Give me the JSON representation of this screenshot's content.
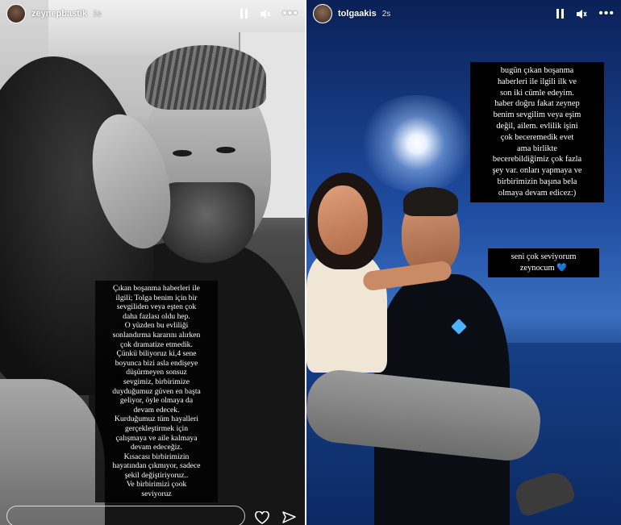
{
  "left_story": {
    "username": "zeynepbastik",
    "time": "1s",
    "caption_lines": [
      "Çıkan boşanma haberleri ile",
      "ilgili; Tolga benim için bir",
      "sevgiliden veya eşten çok",
      "daha fazlası oldu hep.",
      "O yüzden bu evliliği",
      "sonlandırma kararını alırken",
      "çok dramatize etmedik.",
      "Çünkü biliyoruz ki,4 sene",
      "boyunca bizi asla endişeye",
      "düşürmeyen sonsuz",
      "sevgimiz, birbirimize",
      "duyduğumuz güven en başta",
      "geliyor, öyle olmaya da",
      "devam edecek.",
      "Kurduğumuz tüm hayalleri",
      "gerçekleştirmek için",
      "çalışmaya ve aile kalmaya",
      "devam edeceğiz.",
      "Kısacası birbirimizin",
      "hayatından çıkmıyor, sadece",
      "şekil değiştiriyoruz..",
      "Ve birbirimizi çook",
      "seviyoruz"
    ],
    "icons": {
      "pause": "pause-icon",
      "mute": "mute-icon",
      "more": "more-icon",
      "like": "heart-icon",
      "share": "send-icon"
    }
  },
  "right_story": {
    "username": "tolgaakis",
    "time": "2s",
    "caption_lines": [
      "bugün çıkan boşanma",
      "haberleri ile ilgili ilk ve",
      "son iki cümle edeyim.",
      "haber doğru fakat zeynep",
      "benim sevgilim veya eşim",
      "değil, ailem. evlilik işini",
      "çok beceremedik evet",
      "ama birlikte",
      "becerebildiğimiz çok fazla",
      "şey var. onları yapmaya ve",
      "birbirimizin başına bela",
      "olmaya devam edicez:)"
    ],
    "note_lines": [
      "seni çok seviyorum",
      "zeynocum"
    ],
    "note_emoji": "💙",
    "icons": {
      "pause": "pause-icon",
      "mute": "mute-icon",
      "more": "more-icon"
    }
  },
  "colors": {
    "text": "#ffffff",
    "caption_bg": "#000000",
    "heart_emoji": "#4a9cff"
  }
}
